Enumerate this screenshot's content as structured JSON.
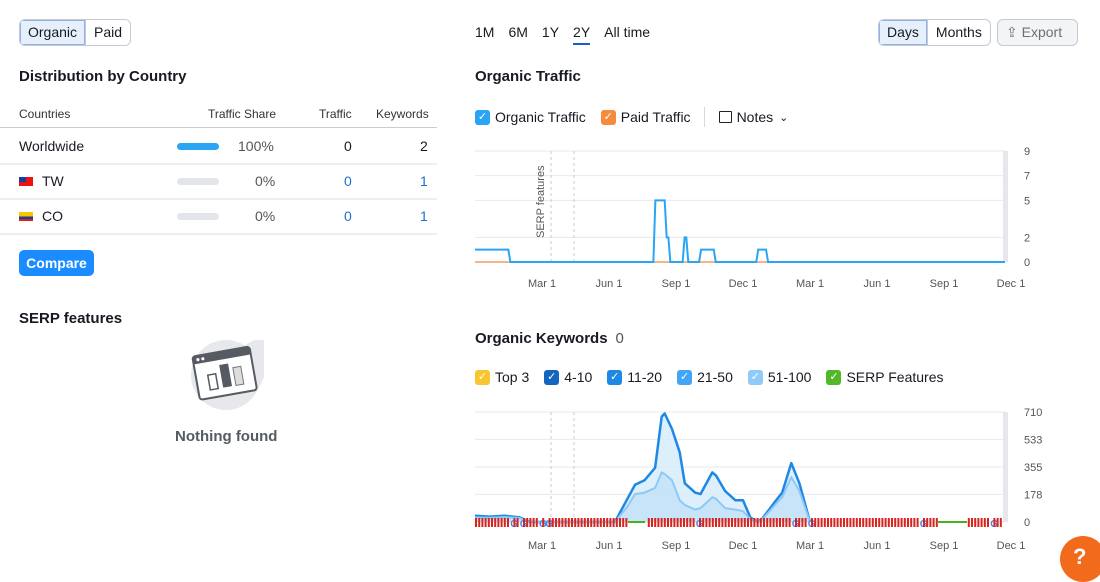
{
  "source_toggle": {
    "items": [
      "Organic",
      "Paid"
    ],
    "active": 0
  },
  "distribution": {
    "title": "Distribution by Country",
    "columns": [
      "Countries",
      "Traffic Share",
      "Traffic",
      "Keywords"
    ],
    "rows": [
      {
        "country": "Worldwide",
        "flag": "",
        "share": "100%",
        "share_value": 100,
        "traffic": "0",
        "keywords": "2"
      },
      {
        "country": "TW",
        "flag": "tw-flag",
        "share": "0%",
        "share_value": 0,
        "traffic": "0",
        "keywords": "1"
      },
      {
        "country": "CO",
        "flag": "co-flag",
        "share": "0%",
        "share_value": 0,
        "traffic": "0",
        "keywords": "1"
      }
    ],
    "compare_label": "Compare"
  },
  "serp": {
    "title": "SERP features",
    "empty_text": "Nothing found"
  },
  "periods": {
    "items": [
      "1M",
      "6M",
      "1Y",
      "2Y",
      "All time"
    ],
    "active": 3
  },
  "granularity": {
    "items": [
      "Days",
      "Months"
    ],
    "active": 0
  },
  "export_label": "Export",
  "colors": {
    "accent": "#1a8cff",
    "organic": "#2aa4f4",
    "paid": "#f58c3d",
    "keywords_top": "#1e88e5",
    "keywords_light": "#8cc9f5",
    "serp": "#d9231d",
    "serp_green": "#4caf1e",
    "help": "#f26b1d"
  },
  "traffic": {
    "title": "Organic Traffic",
    "legend": [
      {
        "label": "Organic Traffic",
        "color": "#2aa4f4"
      },
      {
        "label": "Paid Traffic",
        "color": "#f58c3d"
      }
    ],
    "notes_label": "Notes",
    "annotation": "SERP features"
  },
  "keywords": {
    "title": "Organic Keywords",
    "count": "0",
    "legend": [
      {
        "label": "Top 3",
        "color": "#f8c630"
      },
      {
        "label": "4-10",
        "color": "#1565c0"
      },
      {
        "label": "11-20",
        "color": "#1e88e5"
      },
      {
        "label": "21-50",
        "color": "#42a5f5"
      },
      {
        "label": "51-100",
        "color": "#90caf9"
      },
      {
        "label": "SERP Features",
        "color": "#52b82a"
      }
    ]
  },
  "chart_data": [
    {
      "type": "line",
      "title": "Organic Traffic",
      "x_ticks": [
        "Mar 1",
        "Jun 1",
        "Sep 1",
        "Dec 1",
        "Mar 1",
        "Jun 1",
        "Sep 1",
        "Dec 1"
      ],
      "x_range": [
        "Dec 1",
        "Dec 1"
      ],
      "y_ticks": [
        0,
        2,
        5,
        7,
        9
      ],
      "ylim": [
        0,
        9
      ],
      "grid": true,
      "step": true,
      "series": [
        {
          "name": "Organic Traffic",
          "points": [
            {
              "x": "Dec 1",
              "y": 1
            },
            {
              "x": "Jan 16",
              "y": 0
            },
            {
              "x": "Jul 31",
              "y": 5
            },
            {
              "x": "Aug 16",
              "y": 2
            },
            {
              "x": "Aug 21",
              "y": 0
            },
            {
              "x": "Sep 10",
              "y": 2
            },
            {
              "x": "Sep 15",
              "y": 0
            },
            {
              "x": "Oct 2",
              "y": 1
            },
            {
              "x": "Oct 22",
              "y": 0
            },
            {
              "x": "Dec 19",
              "y": 1
            },
            {
              "x": "Jan 2",
              "y": 0
            },
            {
              "x": "Dec 1",
              "y": 0
            }
          ]
        },
        {
          "name": "Paid Traffic",
          "points": [
            {
              "x": "Dec 1",
              "y": 0
            },
            {
              "x": "Dec 1",
              "y": 0
            }
          ]
        }
      ]
    },
    {
      "type": "area",
      "title": "Organic Keywords",
      "x_ticks": [
        "Mar 1",
        "Jun 1",
        "Sep 1",
        "Dec 1",
        "Mar 1",
        "Jun 1",
        "Sep 1",
        "Dec 1"
      ],
      "x_range": [
        "Dec 1",
        "Dec 1"
      ],
      "y_ticks": [
        0,
        178,
        355,
        533,
        710
      ],
      "ylim": [
        0,
        710
      ],
      "grid": true,
      "series": [
        {
          "points": [
            {
              "x": "Dec 1",
              "y": 40
            },
            {
              "x": "Dec 21",
              "y": 35
            },
            {
              "x": "Jan 11",
              "y": 40
            },
            {
              "x": "Feb 1",
              "y": 30
            },
            {
              "x": "Feb 15",
              "y": 0
            },
            {
              "x": "Jun 9",
              "y": 0
            },
            {
              "x": "Jun 26",
              "y": 150
            },
            {
              "x": "Jul 6",
              "y": 240
            },
            {
              "x": "Jul 19",
              "y": 270
            },
            {
              "x": "Aug 3",
              "y": 350
            },
            {
              "x": "Aug 12",
              "y": 680
            },
            {
              "x": "Aug 16",
              "y": 700
            },
            {
              "x": "Aug 26",
              "y": 600
            },
            {
              "x": "Sep 6",
              "y": 450
            },
            {
              "x": "Sep 13",
              "y": 250
            },
            {
              "x": "Sep 27",
              "y": 190
            },
            {
              "x": "Oct 4",
              "y": 180
            },
            {
              "x": "Oct 20",
              "y": 320
            },
            {
              "x": "Oct 25",
              "y": 300
            },
            {
              "x": "Nov 7",
              "y": 200
            },
            {
              "x": "Nov 21",
              "y": 140
            },
            {
              "x": "Dec 1",
              "y": 140
            },
            {
              "x": "Dec 11",
              "y": 30
            },
            {
              "x": "Dec 21",
              "y": 0
            },
            {
              "x": "Dec 27",
              "y": 20
            },
            {
              "x": "Jan 14",
              "y": 130
            },
            {
              "x": "Jan 24",
              "y": 190
            },
            {
              "x": "Feb 6",
              "y": 380
            },
            {
              "x": "Feb 17",
              "y": 250
            },
            {
              "x": "Mar 1",
              "y": 0
            }
          ]
        },
        {
          "points": [
            {
              "x": "Dec 1",
              "y": 30
            },
            {
              "x": "Dec 21",
              "y": 28
            },
            {
              "x": "Jan 11",
              "y": 32
            },
            {
              "x": "Feb 1",
              "y": 25
            },
            {
              "x": "Feb 15",
              "y": 0
            },
            {
              "x": "Jun 9",
              "y": 0
            },
            {
              "x": "Jun 26",
              "y": 100
            },
            {
              "x": "Jul 6",
              "y": 180
            },
            {
              "x": "Jul 19",
              "y": 190
            },
            {
              "x": "Aug 3",
              "y": 220
            },
            {
              "x": "Aug 12",
              "y": 320
            },
            {
              "x": "Aug 16",
              "y": 310
            },
            {
              "x": "Aug 26",
              "y": 270
            },
            {
              "x": "Sep 6",
              "y": 140
            },
            {
              "x": "Sep 13",
              "y": 110
            },
            {
              "x": "Sep 27",
              "y": 80
            },
            {
              "x": "Oct 4",
              "y": 90
            },
            {
              "x": "Oct 20",
              "y": 160
            },
            {
              "x": "Oct 25",
              "y": 150
            },
            {
              "x": "Nov 7",
              "y": 90
            },
            {
              "x": "Nov 21",
              "y": 80
            },
            {
              "x": "Dec 1",
              "y": 70
            },
            {
              "x": "Dec 11",
              "y": 20
            },
            {
              "x": "Dec 21",
              "y": 0
            },
            {
              "x": "Dec 27",
              "y": 15
            },
            {
              "x": "Jan 14",
              "y": 110
            },
            {
              "x": "Jan 24",
              "y": 160
            },
            {
              "x": "Feb 6",
              "y": 290
            },
            {
              "x": "Feb 17",
              "y": 200
            },
            {
              "x": "Mar 1",
              "y": 0
            }
          ]
        }
      ]
    }
  ]
}
